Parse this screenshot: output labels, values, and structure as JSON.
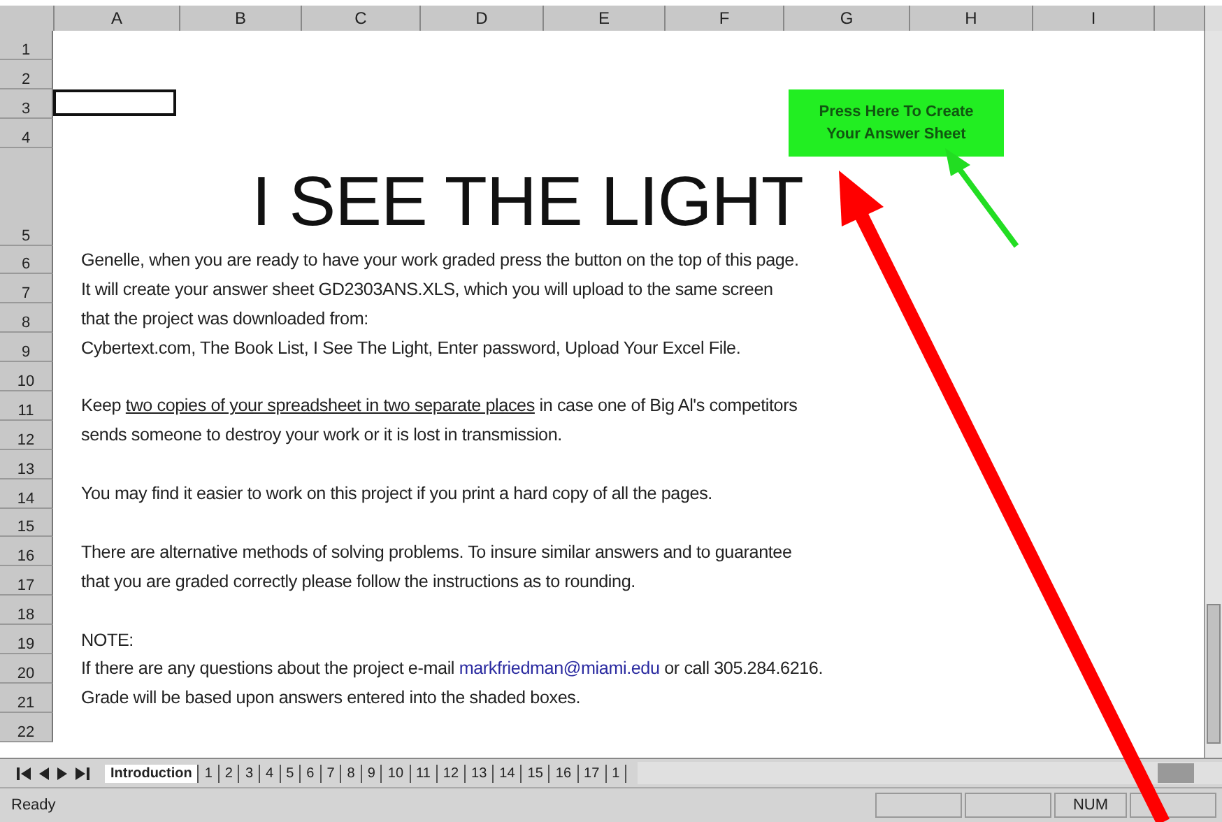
{
  "columns": [
    "A",
    "B",
    "C",
    "D",
    "E",
    "F",
    "G",
    "H",
    "I"
  ],
  "rows": [
    {
      "num": "1"
    },
    {
      "num": "2"
    },
    {
      "num": "3",
      "selected": true
    },
    {
      "num": "4"
    },
    {
      "num": "5",
      "kind": "title",
      "text": "I SEE THE LIGHT"
    },
    {
      "num": "6",
      "text": "Genelle, when you are ready to have your work graded press the button on the top of this page."
    },
    {
      "num": "7",
      "text": "It will create your answer sheet GD2303ANS.XLS, which you will upload to the same screen"
    },
    {
      "num": "8",
      "text": "that the project was downloaded from:"
    },
    {
      "num": "9",
      "text": "Cybertext.com, The Book List, I See The Light, Enter password, Upload Your Excel File."
    },
    {
      "num": "10"
    },
    {
      "num": "11",
      "before": "Keep ",
      "underlined": "two copies of your spreadsheet in two separate places",
      "after": " in case one of Big Al's competitors"
    },
    {
      "num": "12",
      "text": "sends someone to destroy your work or it is lost in transmission."
    },
    {
      "num": "13"
    },
    {
      "num": "14",
      "text": "You may find it easier to work on this project if you print a hard copy of all the pages."
    },
    {
      "num": "15"
    },
    {
      "num": "16",
      "text": "There are alternative methods of solving problems.  To insure similar answers and to guarantee"
    },
    {
      "num": "17",
      "text": "that you are graded correctly please follow the instructions as to rounding."
    },
    {
      "num": "18"
    },
    {
      "num": "19",
      "text": "NOTE:"
    },
    {
      "num": "20",
      "before": "If there are any questions about the project e-mail ",
      "link": "markfriedman@miami.edu",
      "after": " or call 305.284.6216."
    },
    {
      "num": "21",
      "text": "Grade will be based upon answers entered into the shaded boxes."
    },
    {
      "num": "22"
    }
  ],
  "button": "Press Here To Create Your Answer Sheet",
  "sheet_tabs": [
    {
      "label": "Introduction",
      "selected": true
    },
    {
      "label": "1",
      "selected": false
    },
    {
      "label": "2",
      "selected": false
    },
    {
      "label": "3",
      "selected": false
    },
    {
      "label": "4",
      "selected": false
    },
    {
      "label": "5",
      "selected": false
    },
    {
      "label": "6",
      "selected": false
    },
    {
      "label": "7",
      "selected": false
    },
    {
      "label": "8",
      "selected": false
    },
    {
      "label": "9",
      "selected": false
    },
    {
      "label": "10",
      "selected": false
    },
    {
      "label": "11",
      "selected": false
    },
    {
      "label": "12",
      "selected": false
    },
    {
      "label": "13",
      "selected": false
    },
    {
      "label": "14",
      "selected": false
    },
    {
      "label": "15",
      "selected": false
    },
    {
      "label": "16",
      "selected": false
    },
    {
      "label": "17",
      "selected": false
    },
    {
      "label": "1",
      "selected": false
    }
  ],
  "status_bar": {
    "mode": "Ready",
    "indicator": "NUM"
  }
}
